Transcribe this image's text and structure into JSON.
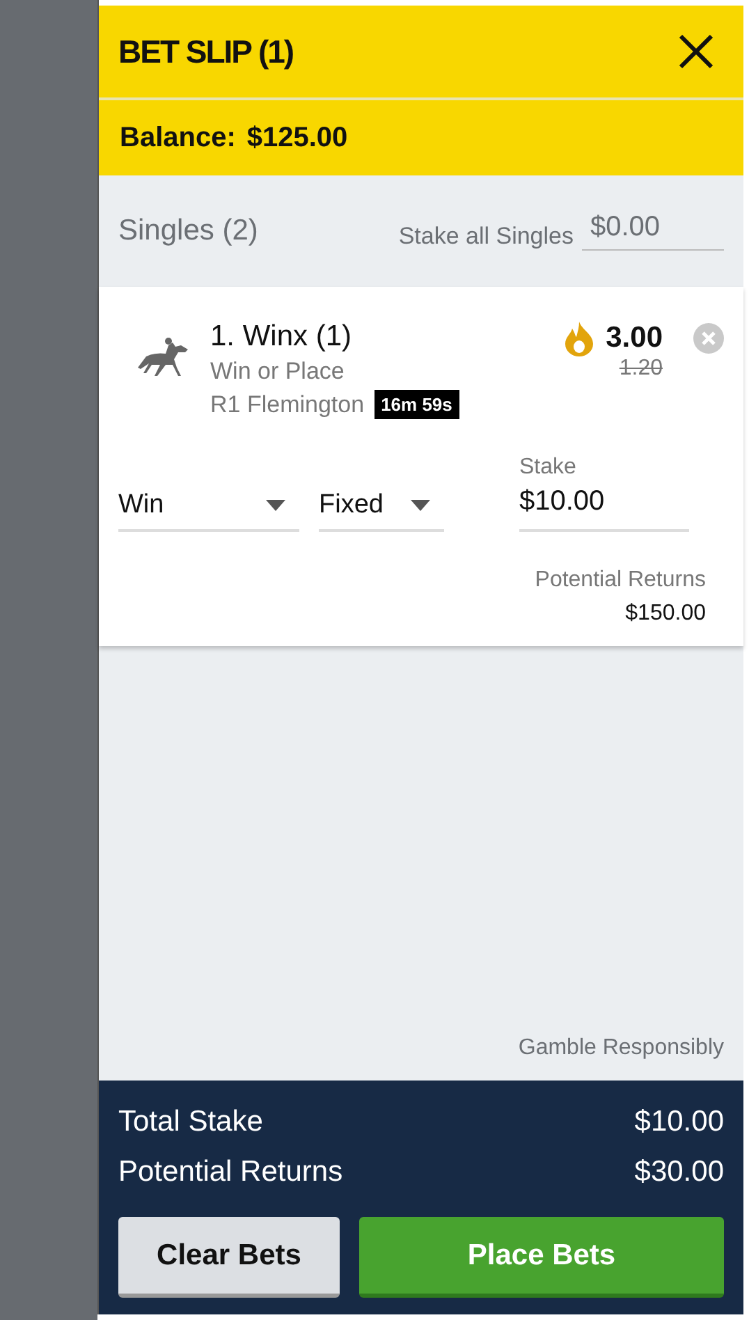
{
  "header": {
    "title": "BET SLIP (1)",
    "balance_label": "Balance:",
    "balance": "$125.00"
  },
  "singles": {
    "title": "Singles (2)",
    "stake_all_label": "Stake all Singles",
    "stake_all_value": "$0.00"
  },
  "bets": [
    {
      "runner": "1. Winx (1)",
      "market": "Win or Place",
      "race": "R1 Flemington",
      "countdown": "16m 59s",
      "price": "3.00",
      "old_price": "1.20",
      "bet_type": "Win",
      "price_type": "Fixed",
      "stake_label": "Stake",
      "stake": "$10.00",
      "returns_label": "Potential Returns",
      "returns": "$150.00"
    }
  ],
  "gamble_note": "Gamble Responsibly",
  "footer": {
    "total_stake_label": "Total Stake",
    "total_stake": "$10.00",
    "returns_label": "Potential Returns",
    "returns": "$30.00"
  },
  "buttons": [
    {
      "label": "Clear Bets",
      "kind": "secondary"
    },
    {
      "label": "Place Bets",
      "kind": "primary"
    }
  ]
}
